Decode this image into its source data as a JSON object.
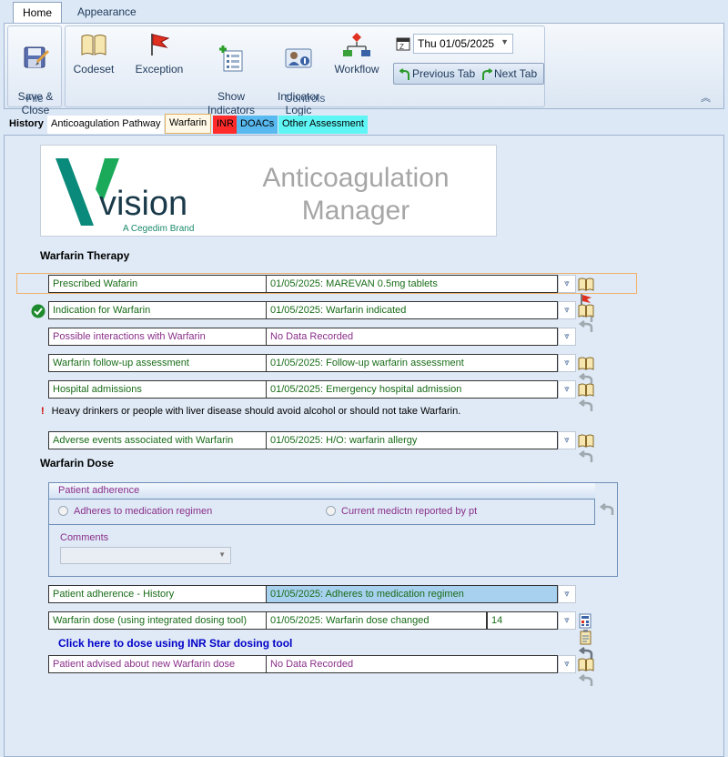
{
  "ribbon": {
    "tabs": [
      "Home",
      "Appearance"
    ],
    "file_group": {
      "label": "File",
      "save_close": "Save &\nClose"
    },
    "controls_group": {
      "label": "Controls",
      "codeset": "Codeset",
      "exception": "Exception",
      "show_indicators": "Show\nIndicators",
      "indicator_logic": "Indicator\nLogic",
      "workflow": "Workflow"
    },
    "date": "Thu 01/05/2025",
    "previous_tab": "Previous Tab",
    "next_tab": "Next Tab"
  },
  "page_tabs": [
    {
      "label": "History",
      "bg": "#dfe9f5"
    },
    {
      "label": "Anticoagulation Pathway",
      "bg": "#ffffff"
    },
    {
      "label": "Warfarin",
      "bg": "#fff8e6"
    },
    {
      "label": "INR",
      "bg": "#ff2b2b"
    },
    {
      "label": "DOACs",
      "bg": "#57b9f0"
    },
    {
      "label": "Other Assessment",
      "bg": "#5ff5f5"
    }
  ],
  "logo": {
    "brand": "vision",
    "tagline": "A Cegedim Brand",
    "title": "Anticoagulation\nManager"
  },
  "sections": {
    "therapy": "Warfarin Therapy",
    "dose": "Warfarin Dose"
  },
  "therapy_rows": [
    {
      "label": "Prescribed Wafarin",
      "value": "01/05/2025: MAREVAN 0.5mg tablets"
    },
    {
      "label": "Indication for Warfarin",
      "value": "01/05/2025: Warfarin indicated"
    },
    {
      "label": "Possible interactions with Warfarin",
      "value": "No Data Recorded"
    },
    {
      "label": "Warfarin follow-up assessment",
      "value": "01/05/2025: Follow-up warfarin assessment"
    },
    {
      "label": "Hospital admissions",
      "value": "01/05/2025: Emergency hospital admission"
    }
  ],
  "warning": "Heavy drinkers or people with liver disease should avoid alcohol or should not take Warfarin.",
  "adverse_row": {
    "label": "Adverse events associated with Warfarin",
    "value": "01/05/2025: H/O: warfarin allergy"
  },
  "adherence_panel": {
    "title": "Patient adherence",
    "option_1": "Adheres to medication regimen",
    "option_2": "Current medictn reported by pt",
    "comments_label": "Comments"
  },
  "dose_rows": [
    {
      "label": "Patient adherence - History",
      "value": "01/05/2025: Adheres to medication regimen"
    },
    {
      "label": "Warfarin dose (using integrated dosing tool)",
      "value": "01/05/2025: Warfarin dose changed",
      "extra": "14"
    }
  ],
  "inr_link": "Click here to dose using INR Star dosing tool",
  "advised_row": {
    "label": "Patient advised about new Warfarin dose",
    "value": "No Data Recorded"
  }
}
